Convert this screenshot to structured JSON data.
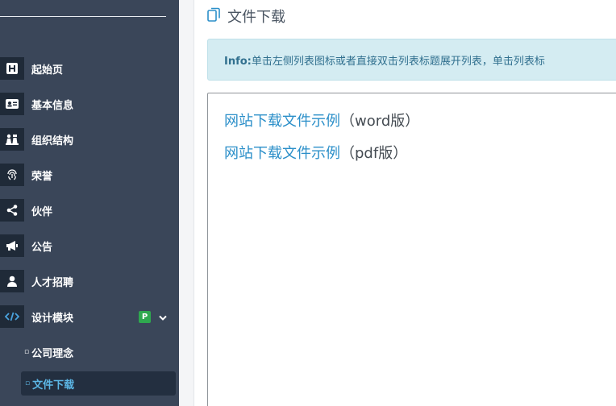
{
  "sidebar": {
    "items": [
      {
        "label": "起始页",
        "icon": "h-square-icon"
      },
      {
        "label": "基本信息",
        "icon": "id-card-icon"
      },
      {
        "label": "组织结构",
        "icon": "chess-pieces-icon"
      },
      {
        "label": "荣誉",
        "icon": "fingerprint-icon"
      },
      {
        "label": "伙伴",
        "icon": "share-icon"
      },
      {
        "label": "公告",
        "icon": "megaphone-icon"
      },
      {
        "label": "人才招聘",
        "icon": "user-icon"
      },
      {
        "label": "设计模块",
        "icon": "code-icon",
        "badge": "P",
        "chevron": "∨"
      }
    ],
    "subitems": [
      {
        "label": "公司理念",
        "bullet": "▫"
      },
      {
        "label": "文件下载",
        "bullet": "▫",
        "active": true
      }
    ]
  },
  "main": {
    "title": "文件下载",
    "title_icon": "copy-icon",
    "info": {
      "prefix": "Info:",
      "text": "单击左侧列表图标或者直接双击列表标题展开列表，单击列表标"
    },
    "files": [
      {
        "link": "网站下载文件示例",
        "suffix": "（word版）"
      },
      {
        "link": "网站下载文件示例",
        "suffix": "（pdf版）"
      }
    ]
  },
  "colors": {
    "sidebar_bg": "#3a4659",
    "icon_bg": "#1f2a38",
    "info_bg": "#d4ecf2",
    "info_text": "#31708f",
    "link": "#2b8fc9",
    "badge": "#2fa84f"
  }
}
